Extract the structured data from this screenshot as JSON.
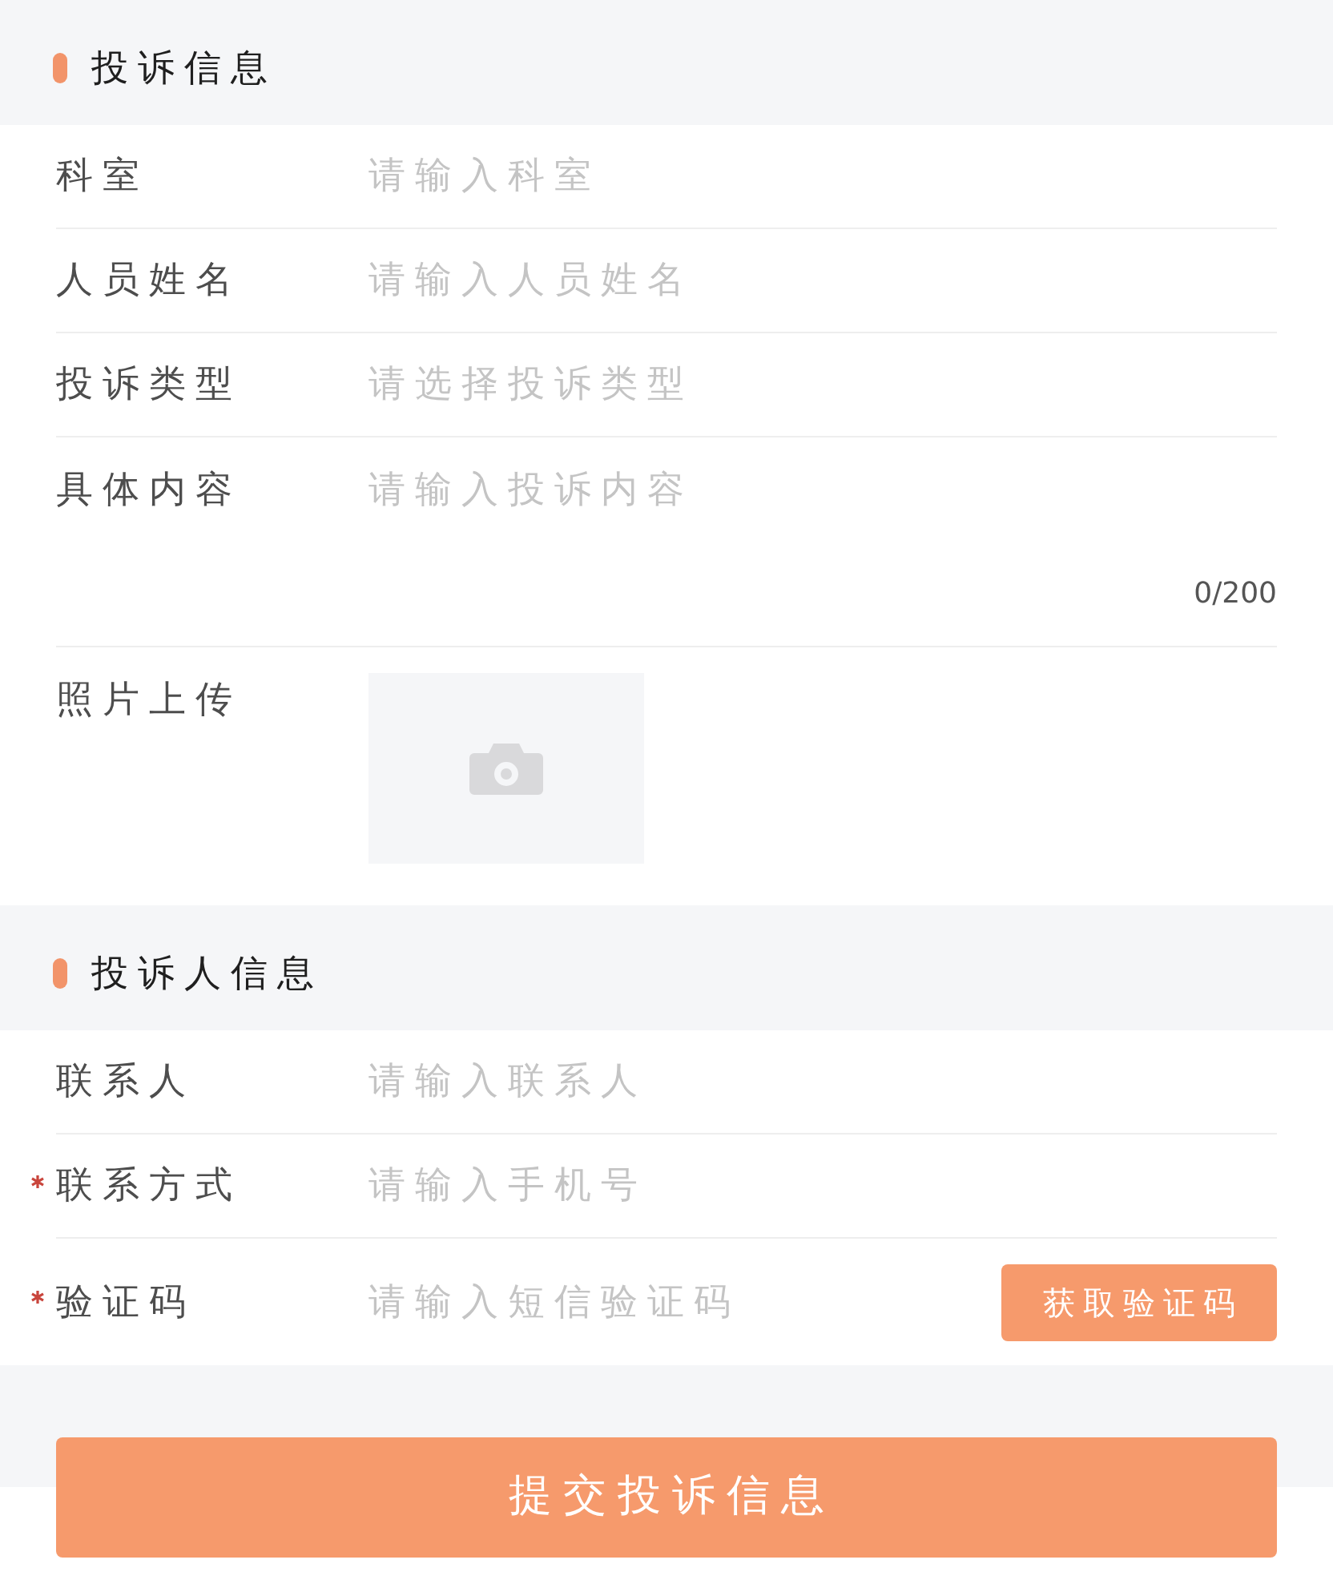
{
  "sections": [
    {
      "title": "投诉信息",
      "fields": [
        {
          "kind": "input",
          "label": "科室",
          "placeholder": "请输入科室",
          "required": false
        },
        {
          "kind": "input",
          "label": "人员姓名",
          "placeholder": "请输入人员姓名",
          "required": false
        },
        {
          "kind": "input",
          "label": "投诉类型",
          "placeholder": "请选择投诉类型",
          "required": false
        },
        {
          "kind": "textarea",
          "label": "具体内容",
          "placeholder": "请输入投诉内容",
          "counter": "0/200",
          "required": false
        },
        {
          "kind": "upload",
          "label": "照片上传",
          "required": false
        }
      ]
    },
    {
      "title": "投诉人信息",
      "fields": [
        {
          "kind": "input",
          "label": "联系人",
          "placeholder": "请输入联系人",
          "required": false
        },
        {
          "kind": "input",
          "label": "联系方式",
          "placeholder": "请输入手机号",
          "required": true
        },
        {
          "kind": "code",
          "label": "验证码",
          "placeholder": "请输入短信验证码",
          "required": true,
          "button": "获取验证码"
        }
      ]
    }
  ],
  "submit_button": "提交投诉信息"
}
